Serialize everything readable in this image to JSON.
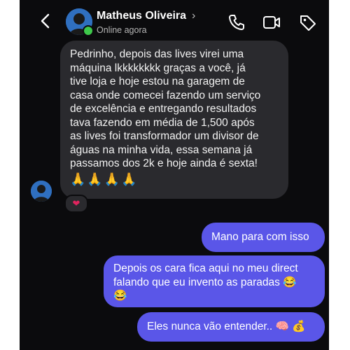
{
  "header": {
    "contact_name": "Matheus Oliveira",
    "status": "Online agora",
    "icons": {
      "back": "chevron-left-icon",
      "profile": "chevron-right-icon",
      "call": "phone-icon",
      "video": "video-icon",
      "tag": "tag-icon"
    }
  },
  "messages": {
    "incoming": {
      "text": "Pedrinho, depois das lives virei uma\nmáquina lkkkkkkkk graças a você, já\ntive loja e hoje estou na garagem de\ncasa onde comecei fazendo um serviço\nde excelência e entregando resultados\ntava fazendo em média de 1,500 após\nas lives foi transformador um divisor de\náguas na minha vida, essa semana já\npassamos dos 2k e hoje ainda é sexta!",
      "emojis": "🙏🙏🙏🙏",
      "reaction": "❤"
    },
    "outgoing": [
      {
        "text": "Mano para com isso"
      },
      {
        "text": "Depois os cara fica aqui no meu direct\nfalando que eu invento as paradas 😂\n😂"
      },
      {
        "text": "Eles nunca vão entender.. 🧠 💰"
      }
    ]
  },
  "colors": {
    "background": "#0b0b0d",
    "incoming_bubble": "#2a2a2e",
    "outgoing_bubble": "#5a56e8",
    "online": "#3ec84b"
  }
}
